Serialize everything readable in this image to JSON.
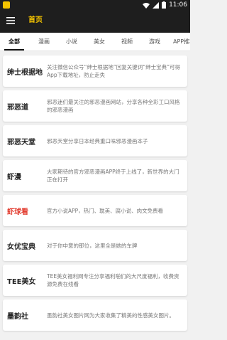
{
  "status_bar": {
    "time": "11:06"
  },
  "app_bar": {
    "title": "首页"
  },
  "tabs": [
    "全部",
    "漫画",
    "小说",
    "美女",
    "视频",
    "游戏",
    "APP推荐"
  ],
  "items": [
    {
      "name": "绅士根据地",
      "description": "关注微信公众号“绅士根据地”回复关键词“绅士宝典”可得App下载地址，防止走失"
    },
    {
      "name": "邪恶道",
      "description": "邪恶迷们最关注的邪恶漫画网站，分享各种全彩工口风格的邪恶漫画"
    },
    {
      "name": "邪恶天堂",
      "description": "邪恶天堂分享日本经典重口味邪恶漫画本子"
    },
    {
      "name": "虾漫",
      "description": "大家期待的官方邪恶漫画APP终于上线了，新世界的大门正在打开"
    },
    {
      "name": "虾球看",
      "description": "官方小说APP，热门、耽美、腐小说、肉文免费看",
      "accent": "#e23b2e"
    },
    {
      "name": "女优宝典",
      "description": "对于你中意的那位，这里全是她的车牌"
    },
    {
      "name": "TEE美女",
      "description": "TEE美女福利网专注分享福利啪们的大尺度福利，收费资源免费在线看"
    },
    {
      "name": "墨韵社",
      "description": "墨韵社美女图片网为大家收集了精美的性感美女图片。"
    }
  ]
}
